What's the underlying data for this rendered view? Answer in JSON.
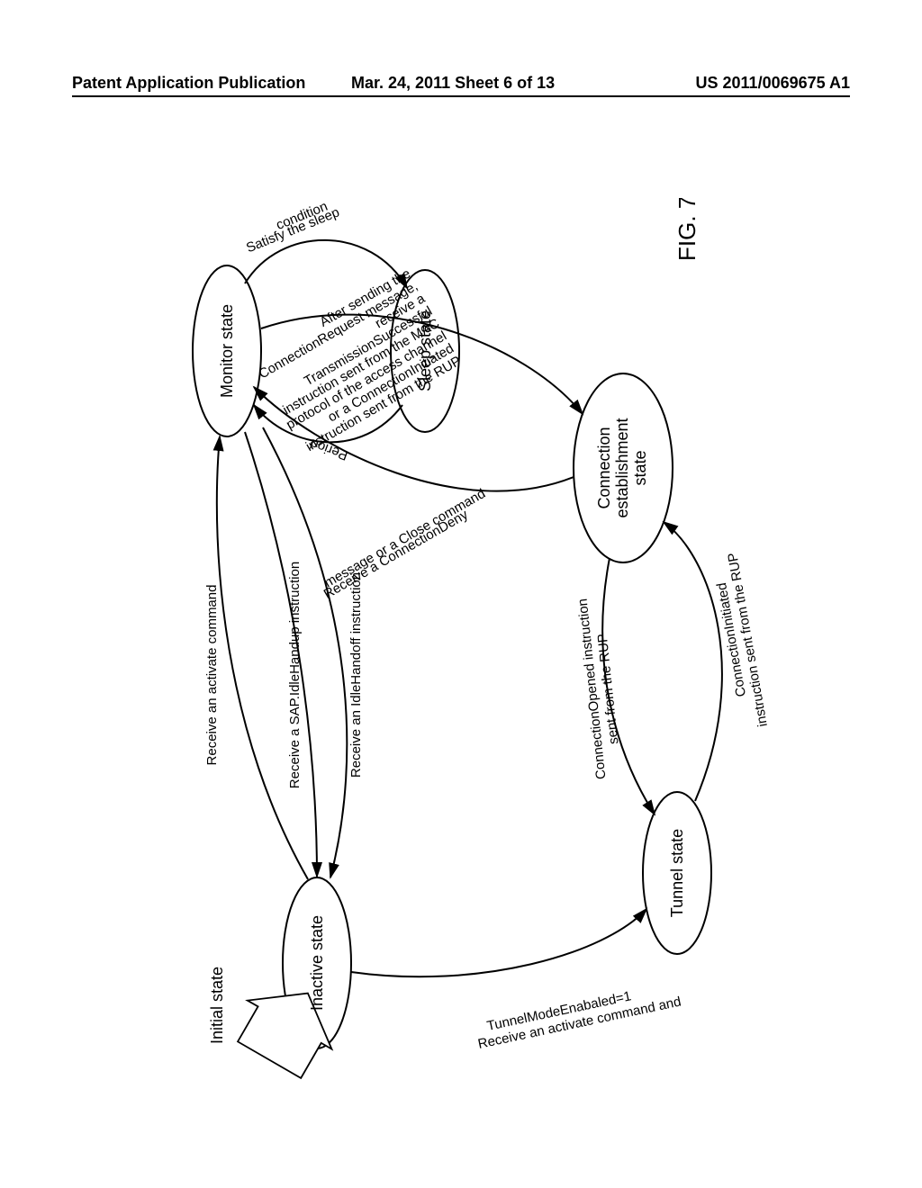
{
  "header": {
    "left": "Patent Application Publication",
    "center": "Mar. 24, 2011  Sheet 6 of 13",
    "right": "US 2011/0069675 A1"
  },
  "figure_label": "FIG. 7",
  "states": {
    "initial": "Initial state",
    "inactive": "Inactive state",
    "monitor": "Monitor state",
    "sleep": "Sleep state",
    "tunnel": "Tunnel state",
    "conn_est_l1": "Connection",
    "conn_est_l2": "establishment",
    "conn_est_l3": "state"
  },
  "edges": {
    "inactive_to_monitor": "Receive an activate command",
    "inactive_to_tunnel_l1": "Receive an activate command and",
    "inactive_to_tunnel_l2": "TunnelModeEnabaled=1",
    "monitor_inactive_sap": "Receive a SAP.IdleHandup instruction",
    "monitor_inactive_idlehandoff": "Receive an IdleHandoff instruction",
    "tunnel_to_connest_l1": "ConnectionInitiated",
    "tunnel_to_connest_l2": "instruction sent from the RUP",
    "connest_to_tunnel_l1": "ConnectionOpened instruction",
    "connest_to_tunnel_l2": "sent from the RUP",
    "monitor_to_connest_l1": "After sending the",
    "monitor_to_connest_l2": "ConnectionRequest message,",
    "monitor_to_connest_l3": "receive a",
    "monitor_to_connest_l4": "TransmissionSuccessful",
    "monitor_to_connest_l5": "instruction sent from the MAC",
    "monitor_to_connest_l6": "protocol of the access channel",
    "monitor_to_connest_l7": "or a ConnectionInitiated",
    "monitor_to_connest_l8": "instruction sent from the RUP",
    "connest_to_monitor_l1": "Receive a ConnectionDeny",
    "connest_to_monitor_l2": "message or a Close command",
    "monitor_sleep_top": "Satisfy the sleep",
    "monitor_sleep_top2": "condition",
    "sleep_monitor": "Period"
  }
}
